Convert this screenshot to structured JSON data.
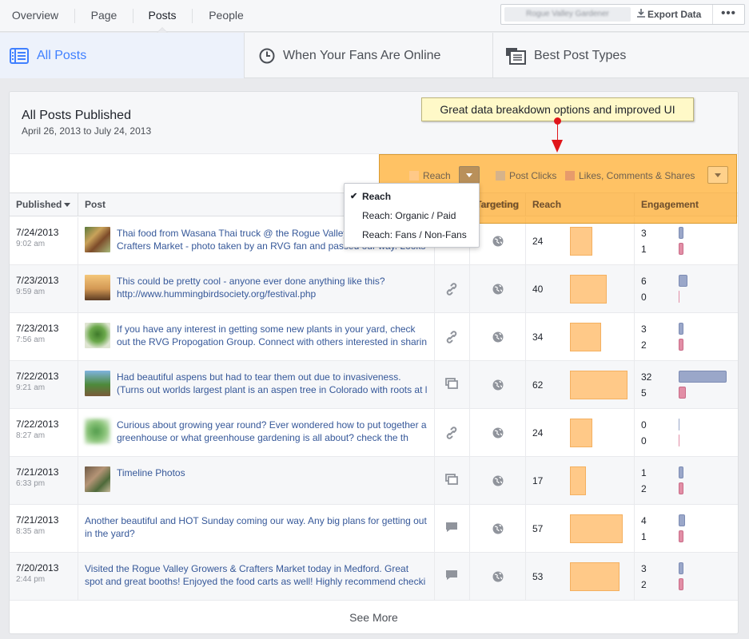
{
  "nav": {
    "tabs": [
      "Overview",
      "Page",
      "Posts",
      "People"
    ],
    "page_selector": "Rogue Valley Gardener",
    "export_label": "Export Data",
    "more_label": "•••"
  },
  "subtabs": [
    "All Posts",
    "When Your Fans Are Online",
    "Best Post Types"
  ],
  "card": {
    "title": "All Posts Published",
    "date_range": "April 26, 2013 to July 24, 2013"
  },
  "callout": "Great data breakdown options and improved UI",
  "metrics": {
    "reach": "Reach",
    "post_clicks": "Post Clicks",
    "likes": "Likes, Comments & Shares",
    "colors": {
      "reach": "#ffc988",
      "post_clicks": "#d6b38a",
      "likes": "#e79b6b"
    }
  },
  "menu": {
    "items": [
      "Reach",
      "Reach: Organic / Paid",
      "Reach: Fans / Non-Fans"
    ],
    "selected": "Reach"
  },
  "columns": {
    "published": "Published",
    "post": "Post",
    "type": "",
    "targeting": "Targeting",
    "reach": "Reach",
    "engagement": "Engagement"
  },
  "rows": [
    {
      "date": "7/24/2013",
      "time": "9:02 am",
      "text": "Thai food from Wasana Thai truck @ the Rogue Valley Growers & Crafters Market - photo taken by an RVG fan and passed our way. Looks tast",
      "thumb": "food",
      "type": "photo",
      "reach": 24,
      "eng1": 3,
      "eng2": 1
    },
    {
      "date": "7/23/2013",
      "time": "9:59 am",
      "text": "This could be pretty cool - anyone ever done anything like this? http://www.hummingbirdsociety.org/festival.php",
      "thumb": "sedona",
      "type": "link",
      "reach": 40,
      "eng1": 6,
      "eng2": 0
    },
    {
      "date": "7/23/2013",
      "time": "7:56 am",
      "text": "If you have any interest in getting some new plants in your yard, check out the RVG Propogation Group. Connect with others interested in sharin",
      "thumb": "plant",
      "type": "link",
      "reach": 34,
      "eng1": 3,
      "eng2": 2
    },
    {
      "date": "7/22/2013",
      "time": "9:21 am",
      "text": "Had beautiful aspens but had to tear them out due to invasiveness. (Turns out worlds largest plant is an aspen tree in Colorado with roots at l",
      "thumb": "aspen",
      "type": "album",
      "reach": 62,
      "eng1": 32,
      "eng2": 5
    },
    {
      "date": "7/22/2013",
      "time": "8:27 am",
      "text": "Curious about growing year round? Ever wondered how to put together a greenhouse or what greenhouse gardening is all about? check the th",
      "thumb": "greenhouse",
      "type": "link",
      "reach": 24,
      "eng1": 0,
      "eng2": 0
    },
    {
      "date": "7/21/2013",
      "time": "6:33 pm",
      "text": "Timeline Photos",
      "thumb": "market",
      "type": "album",
      "reach": 17,
      "eng1": 1,
      "eng2": 2
    },
    {
      "date": "7/21/2013",
      "time": "8:35 am",
      "text": "Another beautiful and HOT Sunday coming our way. Any big plans for getting out in the yard?",
      "thumb": "",
      "type": "status",
      "reach": 57,
      "eng1": 4,
      "eng2": 1
    },
    {
      "date": "7/20/2013",
      "time": "2:44 pm",
      "text": "Visited the Rogue Valley Growers & Crafters Market today in Medford. Great spot and great booths! Enjoyed the food carts as well! Highly recommend checki",
      "thumb": "",
      "type": "status",
      "reach": 53,
      "eng1": 3,
      "eng2": 2
    }
  ],
  "see_more": "See More"
}
